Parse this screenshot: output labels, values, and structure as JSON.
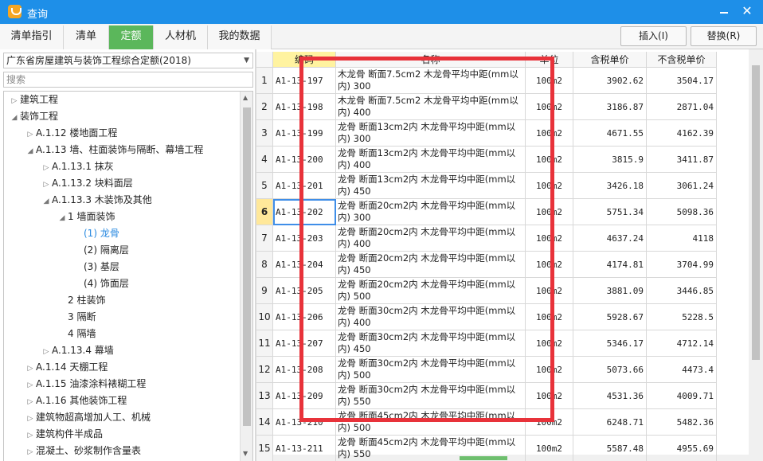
{
  "window": {
    "title": "查询",
    "minimize": "—",
    "close": "✕"
  },
  "tabs": [
    {
      "label": "清单指引"
    },
    {
      "label": "清单"
    },
    {
      "label": "定额"
    },
    {
      "label": "人材机"
    },
    {
      "label": "我的数据"
    }
  ],
  "buttons": {
    "insert": "插入(I)",
    "replace": "替换(R)"
  },
  "left": {
    "library": "广东省房屋建筑与装饰工程综合定额(2018)",
    "search_placeholder": "搜索",
    "tree": [
      {
        "label": "建筑工程",
        "toggle": "▷"
      },
      {
        "label": "装饰工程",
        "toggle": "◢"
      },
      {
        "label": "A.1.12 楼地面工程",
        "toggle": "▷"
      },
      {
        "label": "A.1.13 墙、柱面装饰与隔断、幕墙工程",
        "toggle": "◢"
      },
      {
        "label": "A.1.13.1 抹灰",
        "toggle": "▷"
      },
      {
        "label": "A.1.13.2 块料面层",
        "toggle": "▷"
      },
      {
        "label": "A.1.13.3 木装饰及其他",
        "toggle": "◢"
      },
      {
        "label": "1 墙面装饰",
        "toggle": "◢"
      },
      {
        "label": "(1) 龙骨",
        "toggle": ""
      },
      {
        "label": "(2) 隔离层",
        "toggle": ""
      },
      {
        "label": "(3) 基层",
        "toggle": ""
      },
      {
        "label": "(4) 饰面层",
        "toggle": ""
      },
      {
        "label": "2 柱装饰",
        "toggle": ""
      },
      {
        "label": "3 隔断",
        "toggle": ""
      },
      {
        "label": "4 隔墙",
        "toggle": ""
      },
      {
        "label": "A.1.13.4 幕墙",
        "toggle": "▷"
      },
      {
        "label": "A.1.14 天棚工程",
        "toggle": "▷"
      },
      {
        "label": "A.1.15 油漆涂料裱糊工程",
        "toggle": "▷"
      },
      {
        "label": "A.1.16 其他装饰工程",
        "toggle": "▷"
      },
      {
        "label": "建筑物超高增加人工、机械",
        "toggle": "▷"
      },
      {
        "label": "建筑构件半成品",
        "toggle": "▷"
      },
      {
        "label": "混凝土、砂浆制作含量表",
        "toggle": "▷"
      }
    ]
  },
  "grid": {
    "headers": {
      "num": "",
      "code": "编码",
      "name": "名称",
      "unit": "单位",
      "tax": "含税单价",
      "notax": "不含税单价"
    },
    "rows": [
      {
        "num": "1",
        "code": "A1-13-197",
        "name": "木龙骨 断面7.5cm2 木龙骨平均中距(mm以内) 300",
        "unit": "100m2",
        "tax": "3902.62",
        "notax": "3504.17"
      },
      {
        "num": "2",
        "code": "A1-13-198",
        "name": "木龙骨 断面7.5cm2 木龙骨平均中距(mm以内) 400",
        "unit": "100m2",
        "tax": "3186.87",
        "notax": "2871.04"
      },
      {
        "num": "3",
        "code": "A1-13-199",
        "name": "龙骨 断面13cm2内 木龙骨平均中距(mm以内) 300",
        "unit": "100m2",
        "tax": "4671.55",
        "notax": "4162.39"
      },
      {
        "num": "4",
        "code": "A1-13-200",
        "name": "龙骨 断面13cm2内 木龙骨平均中距(mm以内) 400",
        "unit": "100m2",
        "tax": "3815.9",
        "notax": "3411.87"
      },
      {
        "num": "5",
        "code": "A1-13-201",
        "name": "龙骨 断面13cm2内 木龙骨平均中距(mm以内) 450",
        "unit": "100m2",
        "tax": "3426.18",
        "notax": "3061.24"
      },
      {
        "num": "6",
        "code": "A1-13-202",
        "name": "龙骨 断面20cm2内 木龙骨平均中距(mm以内) 300",
        "unit": "100m2",
        "tax": "5751.34",
        "notax": "5098.36"
      },
      {
        "num": "7",
        "code": "A1-13-203",
        "name": "龙骨 断面20cm2内 木龙骨平均中距(mm以内) 400",
        "unit": "100m2",
        "tax": "4637.24",
        "notax": "4118"
      },
      {
        "num": "8",
        "code": "A1-13-204",
        "name": "龙骨 断面20cm2内 木龙骨平均中距(mm以内) 450",
        "unit": "100m2",
        "tax": "4174.81",
        "notax": "3704.99"
      },
      {
        "num": "9",
        "code": "A1-13-205",
        "name": "龙骨 断面20cm2内 木龙骨平均中距(mm以内) 500",
        "unit": "100m2",
        "tax": "3881.09",
        "notax": "3446.85"
      },
      {
        "num": "10",
        "code": "A1-13-206",
        "name": "龙骨 断面30cm2内 木龙骨平均中距(mm以内) 400",
        "unit": "100m2",
        "tax": "5928.67",
        "notax": "5228.5"
      },
      {
        "num": "11",
        "code": "A1-13-207",
        "name": "龙骨 断面30cm2内 木龙骨平均中距(mm以内) 450",
        "unit": "100m2",
        "tax": "5346.17",
        "notax": "4712.14"
      },
      {
        "num": "12",
        "code": "A1-13-208",
        "name": "龙骨 断面30cm2内 木龙骨平均中距(mm以内) 500",
        "unit": "100m2",
        "tax": "5073.66",
        "notax": "4473.4"
      },
      {
        "num": "13",
        "code": "A1-13-209",
        "name": "龙骨 断面30cm2内 木龙骨平均中距(mm以内) 550",
        "unit": "100m2",
        "tax": "4531.36",
        "notax": "4009.71"
      },
      {
        "num": "14",
        "code": "A1-13-210",
        "name": "龙骨 断面45cm2内 木龙骨平均中距(mm以内) 500",
        "unit": "100m2",
        "tax": "6248.71",
        "notax": "5482.36"
      },
      {
        "num": "15",
        "code": "A1-13-211",
        "name": "龙骨 断面45cm2内 木龙骨平均中距(mm以内) 550",
        "unit": "100m2",
        "tax": "5587.48",
        "notax": "4955.69"
      }
    ]
  },
  "colors": {
    "titlebar": "#1e8fe8",
    "active_tab": "#5bb75b",
    "highlight_box": "#e8323a",
    "tree_selected": "#2a8ae0"
  }
}
